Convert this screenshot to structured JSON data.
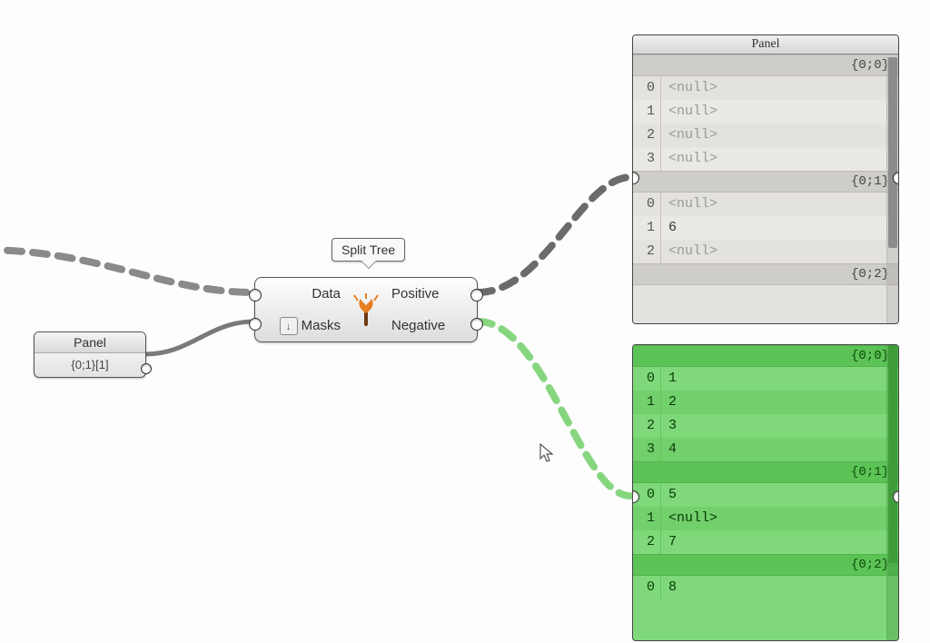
{
  "component": {
    "tooltip": "Split Tree",
    "inputs": [
      "Data",
      "Masks"
    ],
    "outputs": [
      "Positive",
      "Negative"
    ]
  },
  "masks_panel": {
    "title": "Panel",
    "value": "{0;1}[1]"
  },
  "positive_panel": {
    "title": "Panel",
    "branches": [
      {
        "path": "{0;0}",
        "rows": [
          {
            "i": 0,
            "v": "<null>",
            "null": true
          },
          {
            "i": 1,
            "v": "<null>",
            "null": true
          },
          {
            "i": 2,
            "v": "<null>",
            "null": true
          },
          {
            "i": 3,
            "v": "<null>",
            "null": true
          }
        ]
      },
      {
        "path": "{0;1}",
        "rows": [
          {
            "i": 0,
            "v": "<null>",
            "null": true
          },
          {
            "i": 1,
            "v": "6",
            "null": false
          },
          {
            "i": 2,
            "v": "<null>",
            "null": true
          }
        ]
      },
      {
        "path": "{0;2}",
        "rows": []
      }
    ]
  },
  "negative_panel": {
    "branches": [
      {
        "path": "{0;0}",
        "rows": [
          {
            "i": 0,
            "v": "1"
          },
          {
            "i": 1,
            "v": "2"
          },
          {
            "i": 2,
            "v": "3"
          },
          {
            "i": 3,
            "v": "4"
          }
        ]
      },
      {
        "path": "{0;1}",
        "rows": [
          {
            "i": 0,
            "v": "5"
          },
          {
            "i": 1,
            "v": "<null>",
            "null": true
          },
          {
            "i": 2,
            "v": "7"
          }
        ]
      },
      {
        "path": "{0;2}",
        "rows": [
          {
            "i": 0,
            "v": "8"
          }
        ]
      }
    ]
  }
}
